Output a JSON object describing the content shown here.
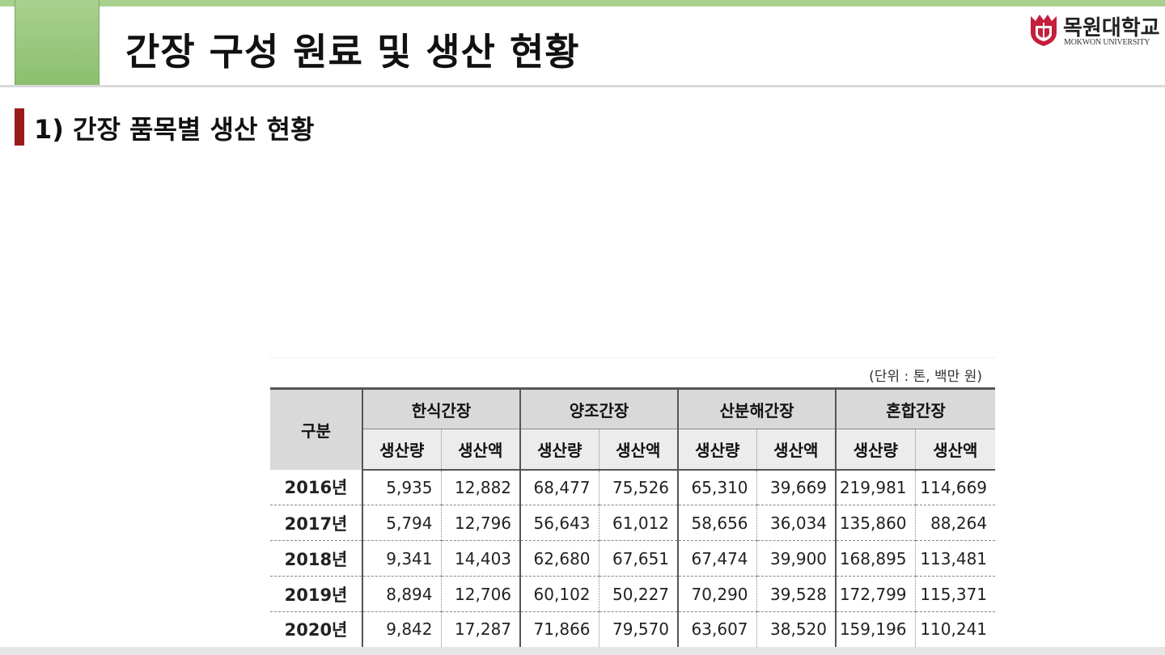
{
  "slide": {
    "title": "간장 구성 원료 및 생산 현황",
    "subtitle": "1) 간장 품목별 생산 현황"
  },
  "logo": {
    "name_ko": "목원대학교",
    "name_en": "MOKWON UNIVERSITY",
    "color": "#c41e3a"
  },
  "table": {
    "unit": "(단위 : 톤, 백만 원)",
    "corner_header": "구분",
    "groups": [
      "한식간장",
      "양조간장",
      "산분해간장",
      "혼합간장"
    ],
    "subheaders": [
      "생산량",
      "생산액",
      "생산량",
      "생산액",
      "생산량",
      "생산액",
      "생산량",
      "생산액"
    ],
    "rows": [
      {
        "year": "2016년",
        "cells": [
          "5,935",
          "12,882",
          "68,477",
          "75,526",
          "65,310",
          "39,669",
          "219,981",
          "114,669"
        ]
      },
      {
        "year": "2017년",
        "cells": [
          "5,794",
          "12,796",
          "56,643",
          "61,012",
          "58,656",
          "36,034",
          "135,860",
          "88,264"
        ]
      },
      {
        "year": "2018년",
        "cells": [
          "9,341",
          "14,403",
          "62,680",
          "67,651",
          "67,474",
          "39,900",
          "168,895",
          "113,481"
        ]
      },
      {
        "year": "2019년",
        "cells": [
          "8,894",
          "12,706",
          "60,102",
          "50,227",
          "70,290",
          "39,528",
          "172,799",
          "115,371"
        ]
      },
      {
        "year": "2020년",
        "cells": [
          "9,842",
          "17,287",
          "71,866",
          "79,570",
          "63,607",
          "38,520",
          "159,196",
          "110,241"
        ]
      }
    ]
  }
}
